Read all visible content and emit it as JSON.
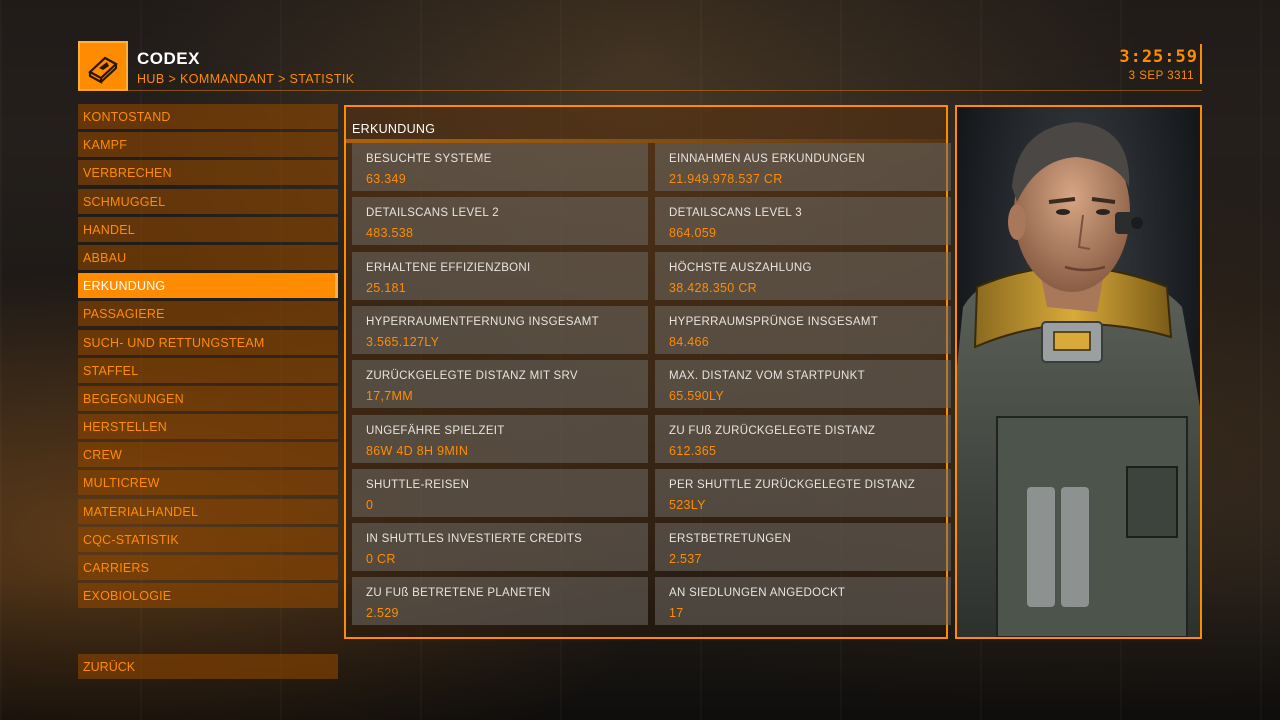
{
  "header": {
    "title": "CODEX",
    "breadcrumb": "HUB > KOMMANDANT > STATISTIK",
    "time": "3:25:59",
    "date": "3 SEP 3311"
  },
  "sidebar": {
    "items": [
      {
        "label": "KONTOSTAND"
      },
      {
        "label": "KAMPF"
      },
      {
        "label": "VERBRECHEN"
      },
      {
        "label": "SCHMUGGEL"
      },
      {
        "label": "HANDEL"
      },
      {
        "label": "ABBAU"
      },
      {
        "label": "ERKUNDUNG",
        "active": true
      },
      {
        "label": "PASSAGIERE"
      },
      {
        "label": "SUCH- UND RETTUNGSTEAM"
      },
      {
        "label": "STAFFEL"
      },
      {
        "label": "BEGEGNUNGEN"
      },
      {
        "label": "HERSTELLEN"
      },
      {
        "label": "CREW"
      },
      {
        "label": "MULTICREW"
      },
      {
        "label": "MATERIALHANDEL"
      },
      {
        "label": "CQC-STATISTIK"
      },
      {
        "label": "CARRIERS"
      },
      {
        "label": "EXOBIOLOGIE"
      }
    ],
    "back_label": "ZURÜCK"
  },
  "main": {
    "section_title": "ERKUNDUNG",
    "stats": [
      {
        "label": "BESUCHTE SYSTEME",
        "value": "63.349"
      },
      {
        "label": "EINNAHMEN AUS ERKUNDUNGEN",
        "value": "21.949.978.537 CR"
      },
      {
        "label": "DETAILSCANS LEVEL 2",
        "value": "483.538"
      },
      {
        "label": "DETAILSCANS LEVEL 3",
        "value": "864.059"
      },
      {
        "label": "ERHALTENE EFFIZIENZBONI",
        "value": "25.181"
      },
      {
        "label": "HÖCHSTE AUSZAHLUNG",
        "value": "38.428.350 CR"
      },
      {
        "label": "HYPERRAUMENTFERNUNG INSGESAMT",
        "value": "3.565.127LY"
      },
      {
        "label": "HYPERRAUMSPRÜNGE INSGESAMT",
        "value": "84.466"
      },
      {
        "label": "ZURÜCKGELEGTE DISTANZ MIT SRV",
        "value": "17,7MM"
      },
      {
        "label": "MAX. DISTANZ VOM STARTPUNKT",
        "value": "65.590LY"
      },
      {
        "label": "UNGEFÄHRE SPIELZEIT",
        "value": "86W 4D 8H 9MIN"
      },
      {
        "label": "ZU FUß ZURÜCKGELEGTE DISTANZ",
        "value": "612.365"
      },
      {
        "label": "SHUTTLE-REISEN",
        "value": "0"
      },
      {
        "label": "PER SHUTTLE ZURÜCKGELEGTE DISTANZ",
        "value": "523LY"
      },
      {
        "label": "IN SHUTTLES INVESTIERTE CREDITS",
        "value": "0 CR"
      },
      {
        "label": "ERSTBETRETUNGEN",
        "value": "2.537"
      },
      {
        "label": "ZU FUß BETRETENE PLANETEN",
        "value": "2.529"
      },
      {
        "label": "AN SIEDLUNGEN ANGEDOCKT",
        "value": "17"
      }
    ]
  },
  "colors": {
    "accent": "#ff8c00",
    "text_light": "#e8e4de",
    "cell_bg": "#6e6964"
  },
  "icons": {
    "header": "codex-book-icon",
    "portrait": "commander-portrait"
  }
}
